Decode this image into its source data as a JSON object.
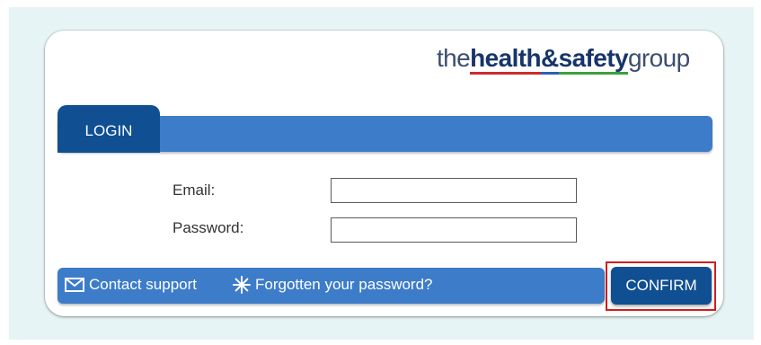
{
  "logo": {
    "prefix": "the",
    "word_health": "health",
    "word_amp": "&",
    "word_safety": "safety",
    "suffix": "group"
  },
  "tabs": [
    {
      "label": "LOGIN",
      "active": true
    }
  ],
  "form": {
    "email_label": "Email:",
    "email_value": "",
    "password_label": "Password:",
    "password_value": ""
  },
  "footer": {
    "contact_label": "Contact support",
    "contact_icon": "envelope-icon",
    "forgot_label": "Forgotten your password?",
    "forgot_icon": "asterisk-icon"
  },
  "confirm_label": "CONFIRM",
  "colors": {
    "accent": "#3d7cc9",
    "accent_dark": "#0f4f92",
    "highlight": "#d41c1c",
    "backdrop": "#e6f4f5"
  }
}
